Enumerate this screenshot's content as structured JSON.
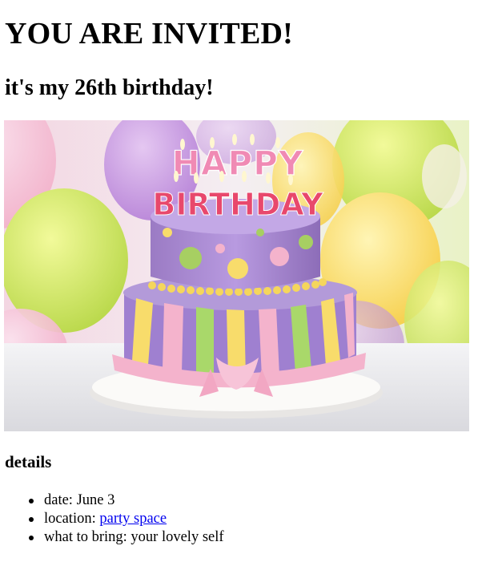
{
  "heading": "YOU ARE INVITED!",
  "subheading": "it's my 26th birthday!",
  "image": {
    "icon": "birthday-cake-photo",
    "topper_line1": "HAPPY",
    "topper_line2": "BIRTHDAY"
  },
  "details": {
    "title": "details",
    "date_label": "date: June 3",
    "location_label": "location: ",
    "location_link": "party space",
    "bring_label": "what to bring: your lovely self"
  },
  "colors": {
    "link": "#0000ee",
    "cake_purple": "#a886d0",
    "ribbon_pink": "#f4b3cc"
  }
}
